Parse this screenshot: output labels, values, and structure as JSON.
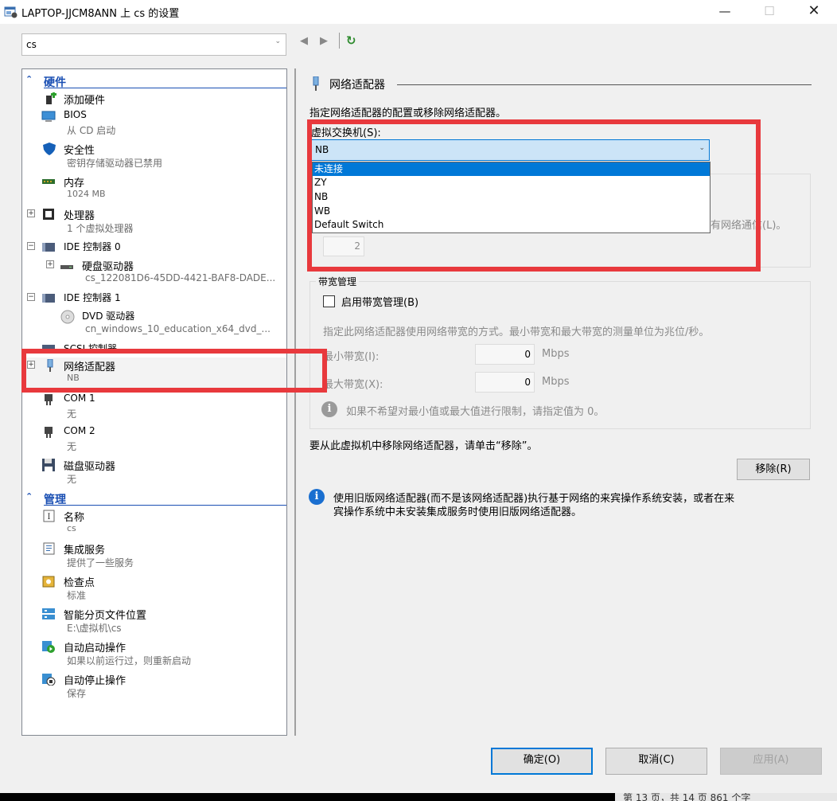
{
  "window": {
    "title": "LAPTOP-JJCM8ANN 上 cs 的设置",
    "minimize": "—",
    "maximize": "☐",
    "close": "✕"
  },
  "vm_selector": {
    "value": "cs"
  },
  "nav": {
    "back": "◀",
    "forward": "▶",
    "refresh": "↻"
  },
  "tree": {
    "hardware_header": "硬件",
    "management_header": "管理",
    "items": [
      {
        "name": "添加硬件",
        "sub": ""
      },
      {
        "name": "BIOS",
        "sub": "从 CD 启动"
      },
      {
        "name": "安全性",
        "sub": "密钥存储驱动器已禁用"
      },
      {
        "name": "内存",
        "sub": "1024 MB"
      },
      {
        "name": "处理器",
        "sub": "1 个虚拟处理器"
      },
      {
        "name": "IDE 控制器 0",
        "sub": ""
      },
      {
        "name": "硬盘驱动器",
        "sub": "cs_122081D6-45DD-4421-BAF8-DADE..."
      },
      {
        "name": "IDE 控制器 1",
        "sub": ""
      },
      {
        "name": "DVD 驱动器",
        "sub": "cn_windows_10_education_x64_dvd_..."
      },
      {
        "name": "SCSI 控制器",
        "sub": ""
      },
      {
        "name": "网络适配器",
        "sub": "NB"
      },
      {
        "name": "COM 1",
        "sub": "无"
      },
      {
        "name": "COM 2",
        "sub": "无"
      },
      {
        "name": "磁盘驱动器",
        "sub": "无"
      },
      {
        "name": "名称",
        "sub": "cs"
      },
      {
        "name": "集成服务",
        "sub": "提供了一些服务"
      },
      {
        "name": "检查点",
        "sub": "标准"
      },
      {
        "name": "智能分页文件位置",
        "sub": "E:\\虚拟机\\cs"
      },
      {
        "name": "自动启动操作",
        "sub": "如果以前运行过，则重新启动"
      },
      {
        "name": "自动停止操作",
        "sub": "保存"
      }
    ]
  },
  "panel": {
    "group_title": "网络适配器",
    "description": "指定网络适配器的配置或移除网络适配器。",
    "switch_label": "虚拟交换机(S):",
    "switch_value": "NB",
    "switch_options": [
      "未连接",
      "ZY",
      "NB",
      "WB",
      "Default Switch"
    ],
    "switch_selected_index": 0,
    "hidden_text_suffix": "有网络通信(L)。",
    "vlan_value": "2",
    "bandwidth_title": "带宽管理",
    "bandwidth_checkbox": "启用带宽管理(B)",
    "bandwidth_desc": "指定此网络适配器使用网络带宽的方式。最小带宽和最大带宽的测量单位为兆位/秒。",
    "min_bw_label": "最小带宽(I):",
    "min_bw_value": "0",
    "max_bw_label": "最大带宽(X):",
    "max_bw_value": "0",
    "unit": "Mbps",
    "bw_hint": "如果不希望对最小值或最大值进行限制，请指定值为 0。",
    "remove_hint": "要从此虚拟机中移除网络适配器，请单击“移除”。",
    "remove_button": "移除(R)",
    "legacy_info_line1": "使用旧版网络适配器(而不是该网络适配器)执行基于网络的来宾操作系统安装，或者在来",
    "legacy_info_line2": "宾操作系统中未安装集成服务时使用旧版网络适配器。"
  },
  "footer": {
    "ok": "确定(O)",
    "cancel": "取消(C)",
    "apply": "应用(A)"
  },
  "taskbar_text": "第 13 页，共 14 页    861 个字    ",
  "colors": {
    "accent": "#0078d7",
    "header_blue": "#1a4fb3",
    "annotation_red": "#e8393d"
  }
}
